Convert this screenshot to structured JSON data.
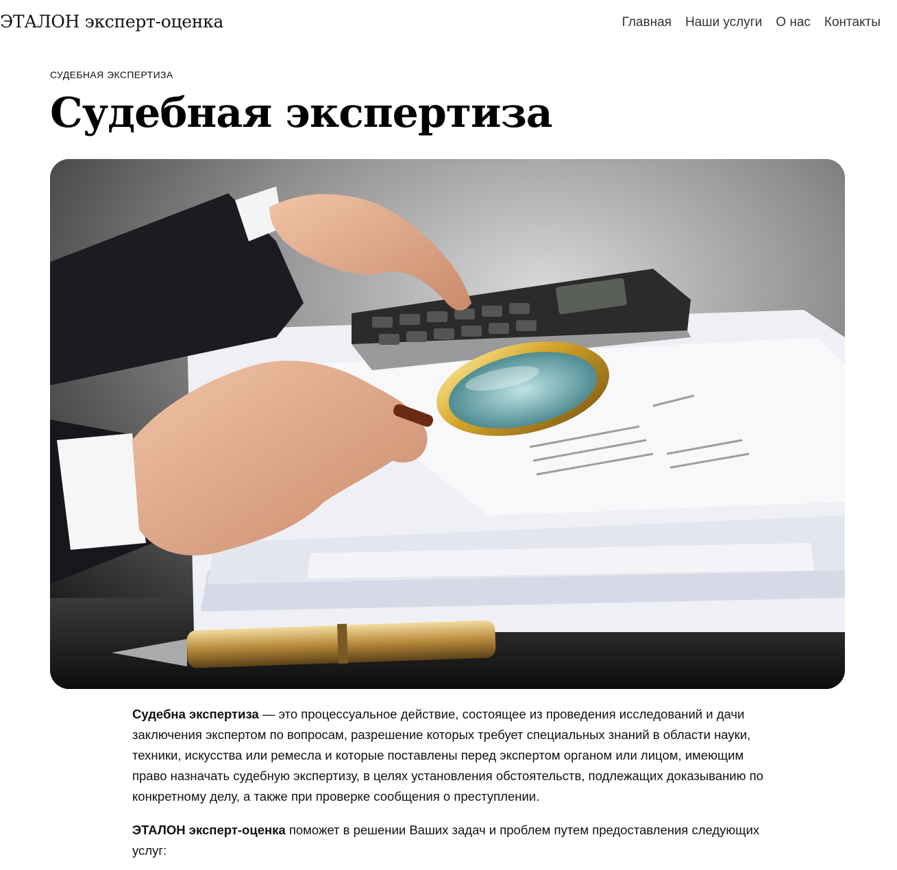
{
  "header": {
    "site_title": "ЭТАЛОН эксперт-оценка",
    "nav": [
      {
        "label": "Главная"
      },
      {
        "label": "Наши услуги"
      },
      {
        "label": "О нас"
      },
      {
        "label": "Контакты"
      }
    ]
  },
  "breadcrumb": "СУДЕБНАЯ ЭКСПЕРТИЗА",
  "page_title": "Судебная экспертиза",
  "hero": {
    "icon": "photo-hands-calculator-magnifier-documents"
  },
  "content": {
    "p1_bold": "Судебна экспертиза",
    "p1_text": " — это процессуальное действие, состоящее из проведения исследований и дачи заключения экспертом по вопросам, разрешение которых требует специальных знаний в области науки, техники, искусства или ремесла и которые поставлены перед экспертом органом или лицом, имеющим право назначать судебную экспертизу, в целях установления обстоятельств, подлежащих доказыванию по конкретному делу, а также при проверке сообщения о преступлении.",
    "p2_bold": "ЭТАЛОН эксперт-оценка",
    "p2_text": " поможет в решении Ваших задач и проблем путем предоставления следующих услуг:"
  }
}
